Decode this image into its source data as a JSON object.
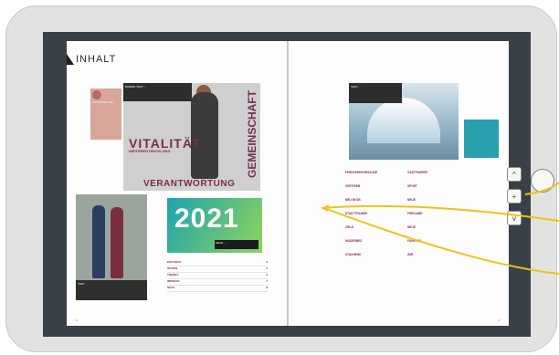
{
  "left_page": {
    "title": "INHALT",
    "sidebox": "3 STUNDEN MIT ...",
    "hero_strip": "RUBRIK TEXT ...",
    "vitalitaet": "VITALITÄT",
    "vitalitaet_sub": "WEITERENTWICKLUNG",
    "gemeinschaft": "GEMEINSCHAFT",
    "verantwortung": "VERANTWORTUNG",
    "team_caption": "TEXT ...",
    "year": "2021",
    "year_label": "NEUE ...",
    "toc": [
      {
        "key": "EDITORIAL",
        "text": "",
        "num": "4"
      },
      {
        "key": "INTERN",
        "text": "",
        "num": "5"
      },
      {
        "key": "TRENDS",
        "text": "",
        "num": "6"
      },
      {
        "key": "IMPRESS",
        "text": "",
        "num": "7"
      },
      {
        "key": "NEUE",
        "text": "",
        "num": "8"
      }
    ],
    "page_no": "2"
  },
  "right_page": {
    "train_strip": "TEXT ...",
    "teal_box": "...",
    "col1": [
      {
        "h": "FERNVERKEHRSZUGE",
        "t": ""
      },
      {
        "h": "VERTRIEB",
        "t": ""
      },
      {
        "h": "NEU IM DB",
        "t": ""
      },
      {
        "h": "STADTTRAINEE",
        "t": ""
      },
      {
        "h": "ZIELE",
        "t": ""
      },
      {
        "h": "MODERNES",
        "t": ""
      },
      {
        "h": "STAUNEND",
        "t": ""
      }
    ],
    "col2": [
      {
        "h": "GASTFAHRER",
        "t": ""
      },
      {
        "h": "SPORT",
        "t": ""
      },
      {
        "h": "NEUE",
        "t": ""
      },
      {
        "h": "FREIGABE",
        "t": ""
      },
      {
        "h": "NEUE",
        "t": ""
      },
      {
        "h": "FAHRTEN",
        "t": ""
      },
      {
        "h": "WIR",
        "t": ""
      }
    ],
    "page_no": "3"
  },
  "controls": {
    "up_label": "^",
    "plus_label": "+",
    "down_label": "v"
  }
}
